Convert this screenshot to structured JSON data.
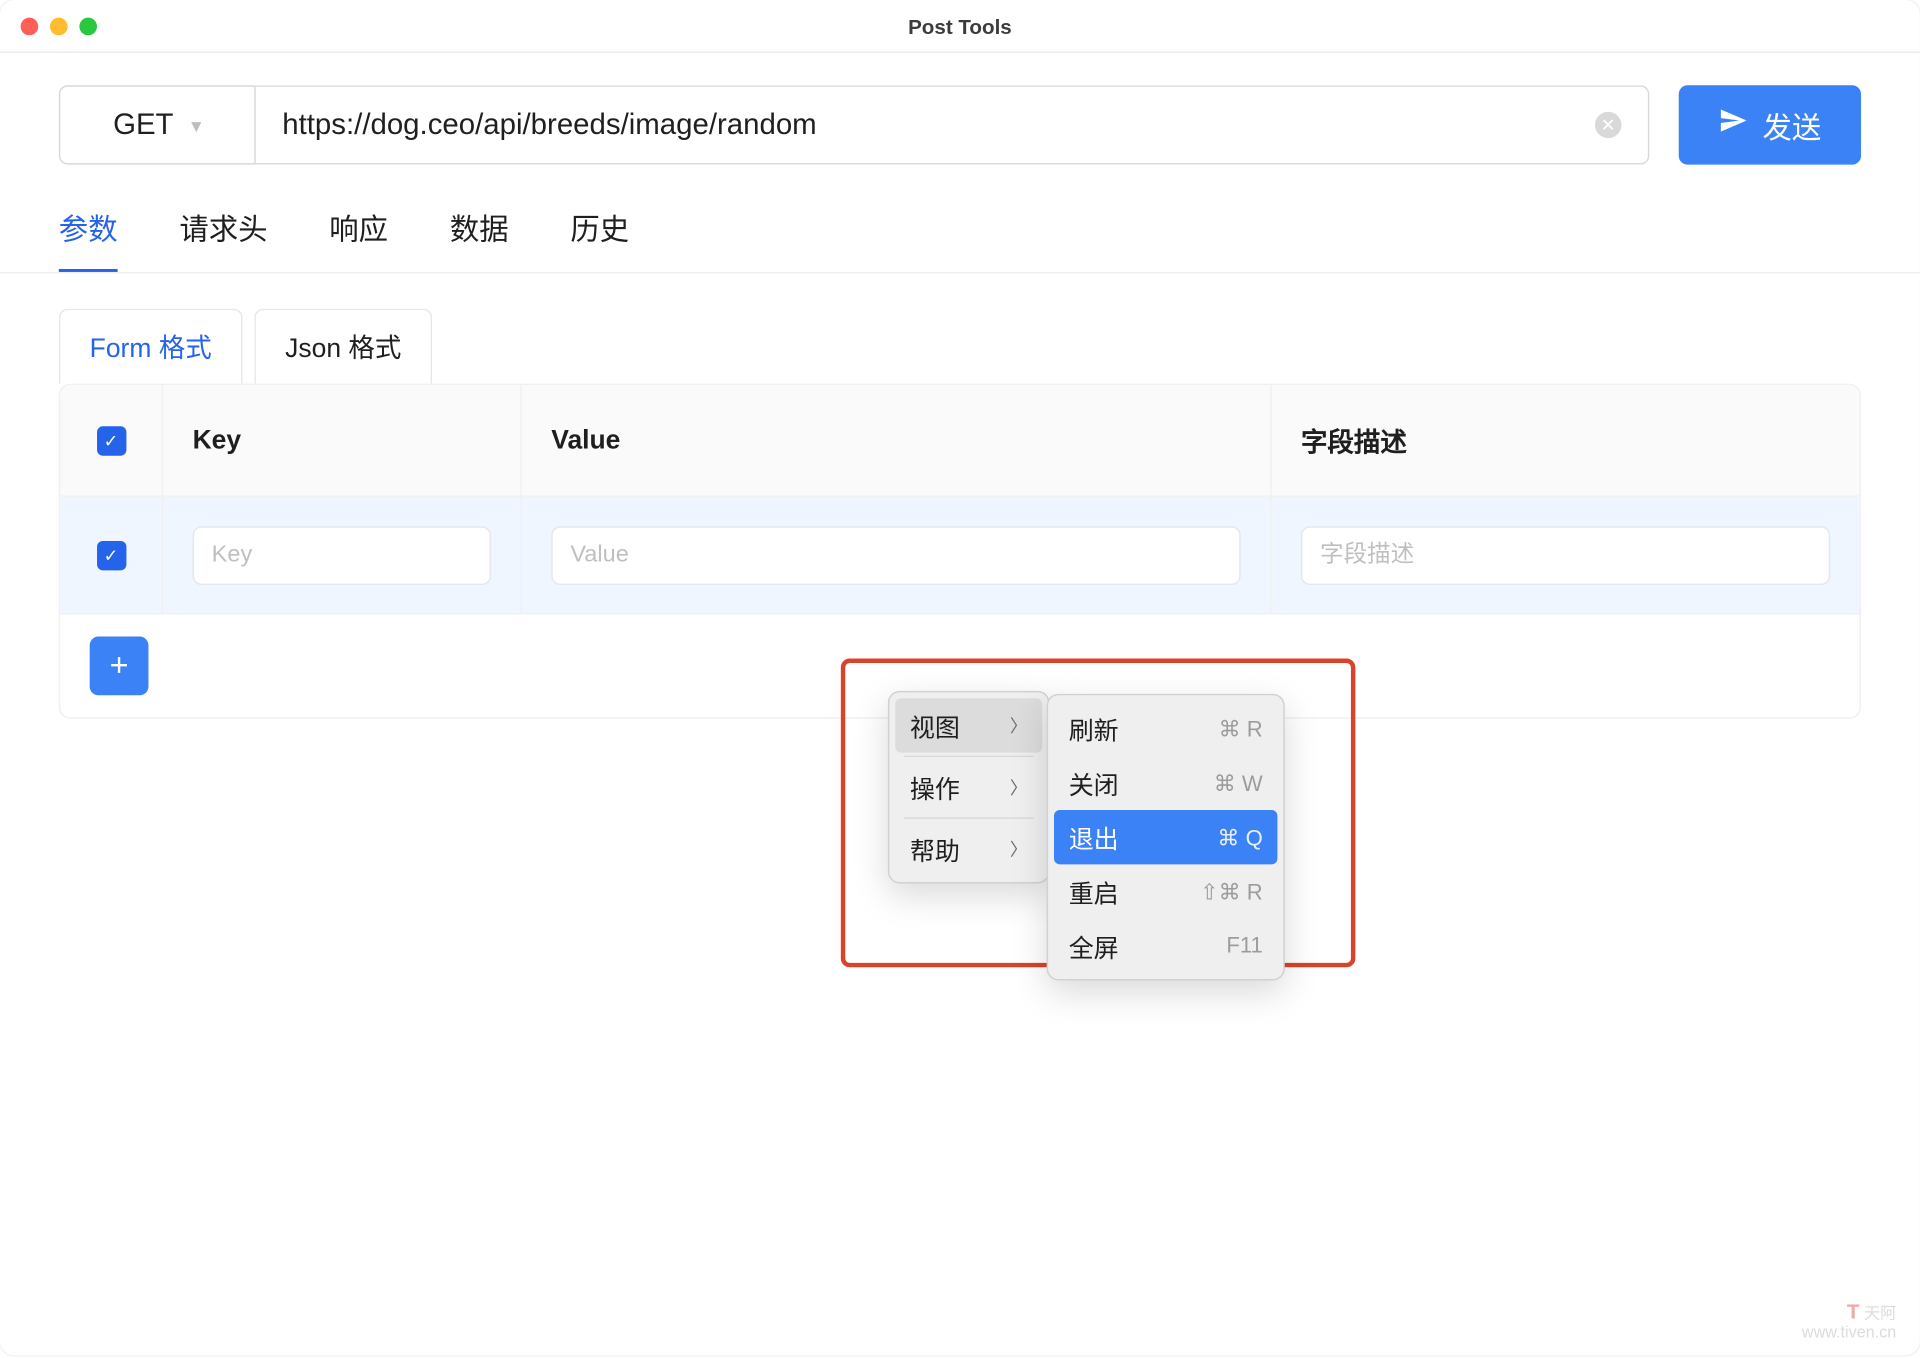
{
  "window": {
    "title": "Post Tools"
  },
  "request": {
    "method": "GET",
    "url": "https://dog.ceo/api/breeds/image/random",
    "send_label": "发送"
  },
  "tabs": {
    "params": "参数",
    "headers": "请求头",
    "response": "响应",
    "data": "数据",
    "history": "历史"
  },
  "subtabs": {
    "form": "Form 格式",
    "json": "Json 格式"
  },
  "table": {
    "headers": {
      "key": "Key",
      "value": "Value",
      "desc": "字段描述"
    },
    "placeholders": {
      "key": "Key",
      "value": "Value",
      "desc": "字段描述"
    }
  },
  "context_menu": {
    "primary": [
      {
        "label": "视图",
        "has_sub": true,
        "hover": true
      },
      {
        "label": "操作",
        "has_sub": true
      },
      {
        "label": "帮助",
        "has_sub": true
      }
    ],
    "secondary": [
      {
        "label": "刷新",
        "shortcut": "⌘ R"
      },
      {
        "label": "关闭",
        "shortcut": "⌘ W"
      },
      {
        "label": "退出",
        "shortcut": "⌘ Q",
        "selected": true
      },
      {
        "label": "重启",
        "shortcut": "⇧⌘ R"
      },
      {
        "label": "全屏",
        "shortcut": "F11"
      }
    ]
  },
  "watermark": {
    "brand": "T",
    "name": "天阿",
    "url": "www.tiven.cn"
  }
}
